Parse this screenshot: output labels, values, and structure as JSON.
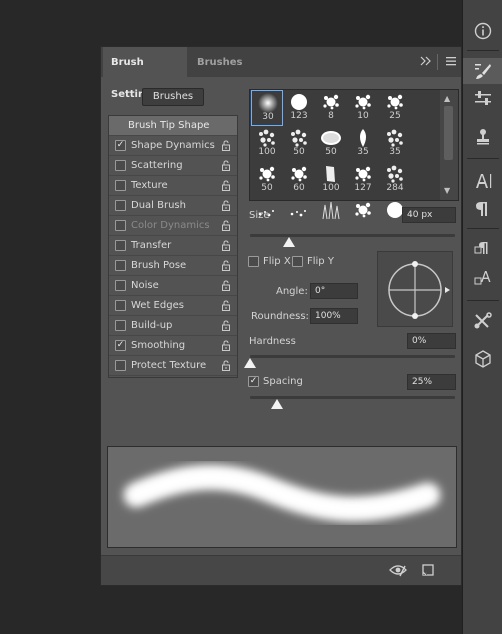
{
  "tabs": {
    "active": "Brush Settings",
    "inactive": "Brushes"
  },
  "brushes_button": "Brushes",
  "options": [
    {
      "label": "Brush Tip Shape",
      "checked": null,
      "selected": true,
      "disabled": false,
      "lock": false
    },
    {
      "label": "Shape Dynamics",
      "checked": true,
      "selected": false,
      "disabled": false,
      "lock": true
    },
    {
      "label": "Scattering",
      "checked": false,
      "selected": false,
      "disabled": false,
      "lock": true
    },
    {
      "label": "Texture",
      "checked": false,
      "selected": false,
      "disabled": false,
      "lock": true
    },
    {
      "label": "Dual Brush",
      "checked": false,
      "selected": false,
      "disabled": false,
      "lock": true
    },
    {
      "label": "Color Dynamics",
      "checked": false,
      "selected": false,
      "disabled": true,
      "lock": true
    },
    {
      "label": "Transfer",
      "checked": false,
      "selected": false,
      "disabled": false,
      "lock": true
    },
    {
      "label": "Brush Pose",
      "checked": false,
      "selected": false,
      "disabled": false,
      "lock": true
    },
    {
      "label": "Noise",
      "checked": false,
      "selected": false,
      "disabled": false,
      "lock": true
    },
    {
      "label": "Wet Edges",
      "checked": false,
      "selected": false,
      "disabled": false,
      "lock": true
    },
    {
      "label": "Build-up",
      "checked": false,
      "selected": false,
      "disabled": false,
      "lock": true
    },
    {
      "label": "Smoothing",
      "checked": true,
      "selected": false,
      "disabled": false,
      "lock": true
    },
    {
      "label": "Protect Texture",
      "checked": false,
      "selected": false,
      "disabled": false,
      "lock": true
    }
  ],
  "presets": [
    {
      "size": "30",
      "kind": "soft",
      "selected": true
    },
    {
      "size": "123",
      "kind": "hard"
    },
    {
      "size": "8",
      "kind": "splat"
    },
    {
      "size": "10",
      "kind": "splat"
    },
    {
      "size": "25",
      "kind": "splat"
    },
    {
      "size": "100",
      "kind": "texture"
    },
    {
      "size": "50",
      "kind": "texture"
    },
    {
      "size": "50",
      "kind": "oval"
    },
    {
      "size": "35",
      "kind": "leaf"
    },
    {
      "size": "35",
      "kind": "texture"
    },
    {
      "size": "50",
      "kind": "splat"
    },
    {
      "size": "60",
      "kind": "splat"
    },
    {
      "size": "100",
      "kind": "chalk"
    },
    {
      "size": "127",
      "kind": "splat"
    },
    {
      "size": "284",
      "kind": "texture"
    },
    {
      "size": "",
      "kind": "dots"
    },
    {
      "size": "",
      "kind": "dots"
    },
    {
      "size": "",
      "kind": "grass"
    },
    {
      "size": "",
      "kind": "splat"
    },
    {
      "size": "",
      "kind": "hard"
    }
  ],
  "size": {
    "label": "Size",
    "value": "40 px",
    "level": 0.19
  },
  "flip_x": {
    "label": "Flip X",
    "checked": false
  },
  "flip_y": {
    "label": "Flip Y",
    "checked": false
  },
  "angle": {
    "label": "Angle:",
    "value": "0°"
  },
  "roundness": {
    "label": "Roundness:",
    "value": "100%"
  },
  "hardness": {
    "label": "Hardness",
    "value": "0%",
    "level": 0.0
  },
  "spacing": {
    "label": "Spacing",
    "value": "25%",
    "checked": true,
    "level": 0.13
  },
  "colors": {
    "panel": "#535353",
    "dark": "#3c3c3c",
    "accent": "#6ab0ff"
  },
  "icons": {
    "toolbar": [
      "info-icon",
      "brush-settings-icon",
      "adjustments-icon",
      "clone-source-icon",
      "character-icon",
      "paragraph-icon",
      "paragraph-styles-icon",
      "character-styles-icon",
      "tools-icon",
      "3d-icon"
    ],
    "bottom": [
      "toggle-preview-icon",
      "new-preset-icon"
    ],
    "tabbar": [
      "collapse-icon",
      "panel-menu-icon"
    ]
  }
}
